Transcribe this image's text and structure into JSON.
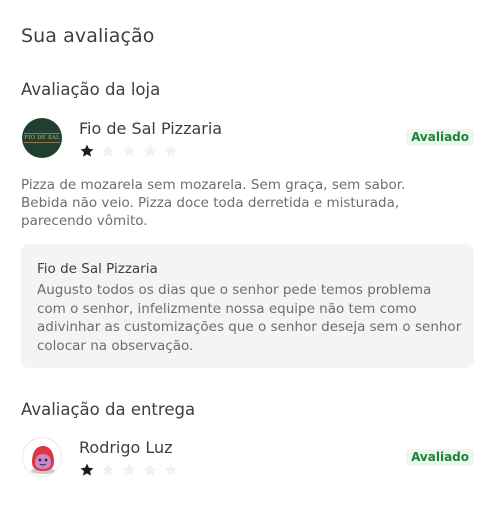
{
  "page": {
    "title": "Sua avaliação"
  },
  "store_review": {
    "section_title": "Avaliação da loja",
    "logo_text": "FIO DE SAL",
    "store_name": "Fio de Sal Pizzaria",
    "rating": 1,
    "max_rating": 5,
    "status_badge": "Avaliado",
    "comment": "Pizza de mozarela sem mozarela. Sem graça, sem sabor. Bebida não veio. Pizza doce toda derretida e misturada, parecendo vômito.",
    "reply": {
      "author": "Fio de Sal Pizzaria",
      "text": "Augusto todos os dias que o senhor pede temos problema com o senhor, infelizmente nossa equipe não tem como adivinhar as customizações que o senhor deseja sem o senhor colocar na observação."
    }
  },
  "delivery_review": {
    "section_title": "Avaliação da entrega",
    "courier_name": "Rodrigo Luz",
    "rating": 1,
    "max_rating": 5,
    "status_badge": "Avaliado"
  },
  "colors": {
    "star_filled": "#1c1c1c",
    "star_empty": "#f1f1f1",
    "badge_bg": "#eaf7ed",
    "badge_text": "#21813a",
    "reply_bg": "#f4f4f4",
    "store_logo_bg": "#203f2e",
    "courier_avatar": "#e2343f"
  },
  "icons": {
    "star": "star-icon",
    "courier_avatar": "courier-avatar-icon"
  }
}
